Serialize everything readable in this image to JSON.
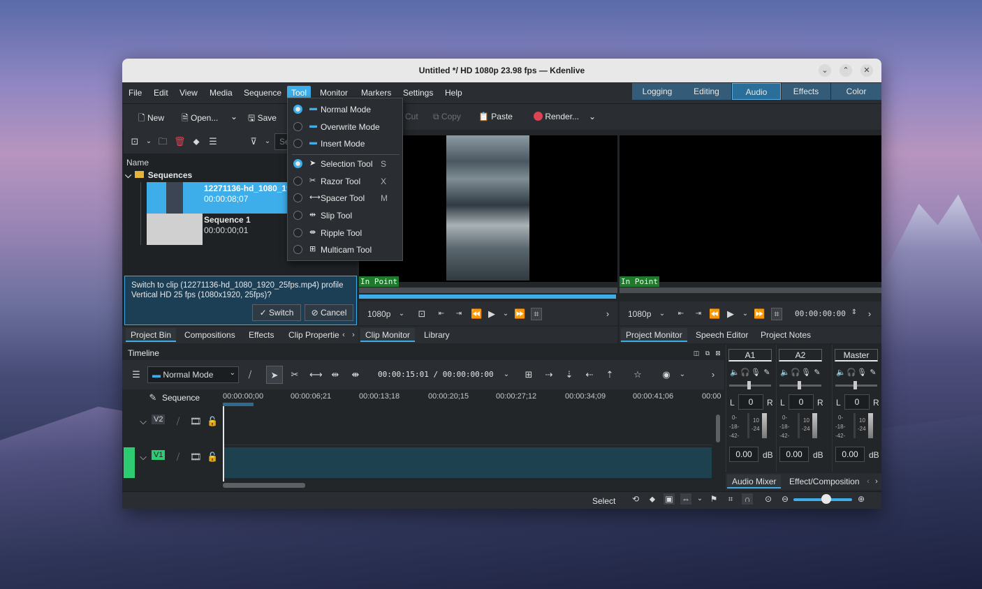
{
  "window": {
    "title": "Untitled */ HD 1080p 23.98 fps — Kdenlive"
  },
  "menus": [
    "File",
    "Edit",
    "View",
    "Media",
    "Sequence",
    "Tool",
    "Monitor",
    "Markers",
    "Settings",
    "Help"
  ],
  "workspaces": [
    "Logging",
    "Editing",
    "Audio",
    "Effects",
    "Color"
  ],
  "toolbar": {
    "new": "New",
    "open": "Open...",
    "save": "Save",
    "cut": "Cut",
    "copy": "Copy",
    "paste": "Paste",
    "render": "Render..."
  },
  "bin": {
    "name_header": "Name",
    "search_placeholder": "Se",
    "folder": "Sequences",
    "clip1": {
      "name": "12271136-hd_1080_1920",
      "duration": "00:00:08;07"
    },
    "clip2": {
      "name": "Sequence 1",
      "duration": "00:00:00;01"
    }
  },
  "notice": {
    "text": "Switch to clip (12271136-hd_1080_1920_25fps.mp4) profile Vertical HD 25 fps (1080x1920, 25fps)?",
    "switch": "Switch",
    "cancel": "Cancel"
  },
  "bin_tabs": [
    "Project Bin",
    "Compositions",
    "Effects",
    "Clip Propertie"
  ],
  "tool_menu": {
    "modes": [
      {
        "label": "Normal Mode",
        "checked": true
      },
      {
        "label": "Overwrite Mode",
        "checked": false
      },
      {
        "label": "Insert Mode",
        "checked": false
      }
    ],
    "tools": [
      {
        "label": "Selection Tool",
        "key": "S",
        "checked": true
      },
      {
        "label": "Razor Tool",
        "key": "X",
        "checked": false
      },
      {
        "label": "Spacer Tool",
        "key": "M",
        "checked": false
      },
      {
        "label": "Slip Tool",
        "key": "",
        "checked": false
      },
      {
        "label": "Ripple Tool",
        "key": "",
        "checked": false
      },
      {
        "label": "Multicam Tool",
        "key": "",
        "checked": false
      }
    ]
  },
  "clip_monitor": {
    "in_point": "In Point",
    "resolution": "1080p",
    "tabs": [
      "Clip Monitor",
      "Library"
    ]
  },
  "project_monitor": {
    "in_point": "In Point",
    "resolution": "1080p",
    "timecode": "00:00:00:00",
    "tabs": [
      "Project Monitor",
      "Speech Editor",
      "Project Notes"
    ]
  },
  "timeline": {
    "title": "Timeline",
    "mode": "Normal Mode",
    "timecode": "00:00:15:01 / 00:00:00:00",
    "sequence_label": "Sequence",
    "ruler": [
      "00:00:00;00",
      "00:00:06;21",
      "00:00:13;18",
      "00:00:20;15",
      "00:00:27;12",
      "00:00:34;09",
      "00:00:41;06",
      "00:00"
    ],
    "tracks": [
      {
        "name": "V2"
      },
      {
        "name": "V1"
      }
    ]
  },
  "mixer": {
    "channels": [
      {
        "name": "A1",
        "value": "0",
        "db": "0.00"
      },
      {
        "name": "A2",
        "value": "0",
        "db": "0.00"
      },
      {
        "name": "Master",
        "value": "0",
        "db": "0.00"
      }
    ],
    "l": "L",
    "r": "R",
    "unit": "dB",
    "scale": [
      "0-",
      "-18-",
      "-42-"
    ],
    "scale2": [
      "10",
      "-24"
    ],
    "tabs": [
      "Audio Mixer",
      "Effect/Composition"
    ]
  },
  "status": {
    "mode": "Select"
  }
}
